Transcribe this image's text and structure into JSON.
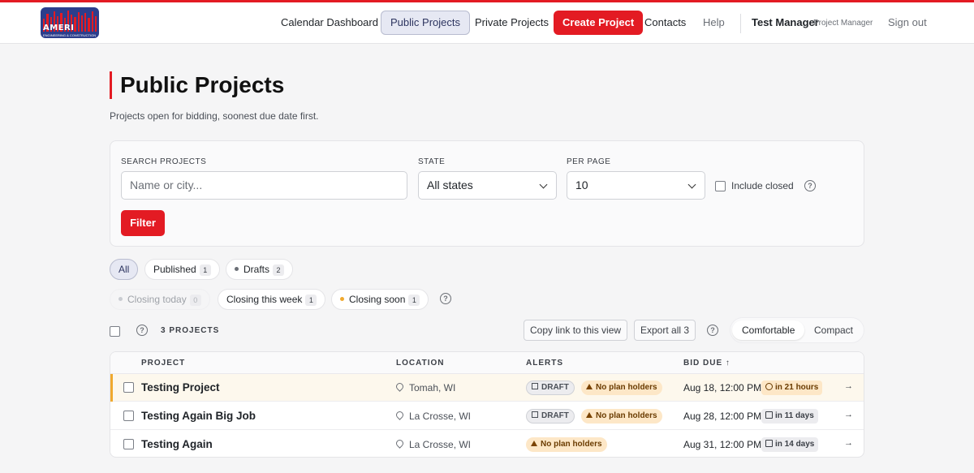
{
  "brand": {
    "logo_text": "AMERI",
    "logo_subtext": "ENGINEERING & CONSTRUCTION",
    "accent_color": "#e31b23"
  },
  "nav": {
    "items": [
      {
        "label": "Calendar Dashboard"
      },
      {
        "label": "Public Projects",
        "active": true
      },
      {
        "label": "Private Projects"
      },
      {
        "label": "Create Project"
      },
      {
        "label": "Contacts"
      },
      {
        "label": "Help"
      }
    ],
    "user_name": "Test Manager",
    "user_role": "Project Manager",
    "sign_out": "Sign out"
  },
  "page": {
    "title": "Public Projects",
    "subtitle": "Projects open for bidding, soonest due date first."
  },
  "filters": {
    "search_label": "SEARCH PROJECTS",
    "search_placeholder": "Name or city...",
    "state_label": "STATE",
    "state_value": "All states",
    "per_page_label": "PER PAGE",
    "per_page_value": "10",
    "include_closed_label": "Include closed",
    "filter_button": "Filter",
    "help_glyph": "?"
  },
  "status_pills": [
    {
      "label": "All",
      "active": true
    },
    {
      "label": "Published",
      "count": "1"
    },
    {
      "label": "Drafts",
      "count": "2",
      "dot_color": "#6b6f76"
    }
  ],
  "timing_pills": [
    {
      "label": "Closing today",
      "count": "0",
      "dot_color": "#c9ccd1",
      "faded": true
    },
    {
      "label": "Closing this week",
      "count": "1"
    },
    {
      "label": "Closing soon",
      "count": "1",
      "dot_color": "#f0a92e"
    }
  ],
  "toolbar": {
    "count_label": "3 PROJECTS",
    "copy_link": "Copy link to this view",
    "export": "Export all 3",
    "density_comfortable": "Comfortable",
    "density_compact": "Compact"
  },
  "table": {
    "columns": [
      "PROJECT",
      "LOCATION",
      "ALERTS",
      "BID DUE ↑"
    ],
    "rows": [
      {
        "name": "Testing Project",
        "location": "Tomah, WI",
        "draft": "DRAFT",
        "alert": "No plan holders",
        "due": "Aug 18, 12:00 PM",
        "relative": "in 21 hours",
        "soon": true
      },
      {
        "name": "Testing Again Big Job",
        "location": "La Crosse, WI",
        "draft": "DRAFT",
        "alert": "No plan holders",
        "due": "Aug 28, 12:00 PM",
        "relative": "in 11 days",
        "soon": false
      },
      {
        "name": "Testing Again",
        "location": "La Crosse, WI",
        "draft": "",
        "alert": "No plan holders",
        "due": "Aug 31, 12:00 PM",
        "relative": "in 14 days",
        "soon": false
      }
    ],
    "row_arrow": "→"
  }
}
